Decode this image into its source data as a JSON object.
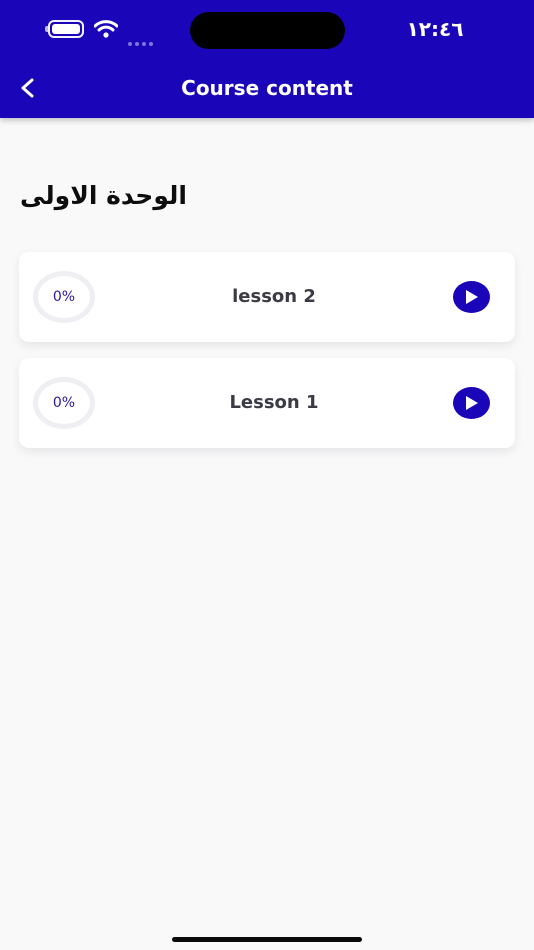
{
  "status_bar": {
    "time": "١٢:٤٦",
    "battery_icon": "battery-icon",
    "wifi_icon": "wifi-icon",
    "signal_icon": "cellular-signal-icon"
  },
  "nav_bar": {
    "title": "Course content",
    "back_icon": "chevron-left-icon"
  },
  "section": {
    "title": "الوحدة الاولى"
  },
  "lessons": [
    {
      "title": "lesson 2",
      "progress_label": "0%",
      "progress": 0,
      "play_icon": "play-icon"
    },
    {
      "title": "Lesson 1",
      "progress_label": "0%",
      "progress": 0,
      "play_icon": "play-icon"
    }
  ],
  "colors": {
    "brand": "#1a06b8",
    "background": "#f9f9fa",
    "card": "#ffffff",
    "lesson_text": "#3b3b46",
    "progress_text": "#2b1a9a"
  }
}
